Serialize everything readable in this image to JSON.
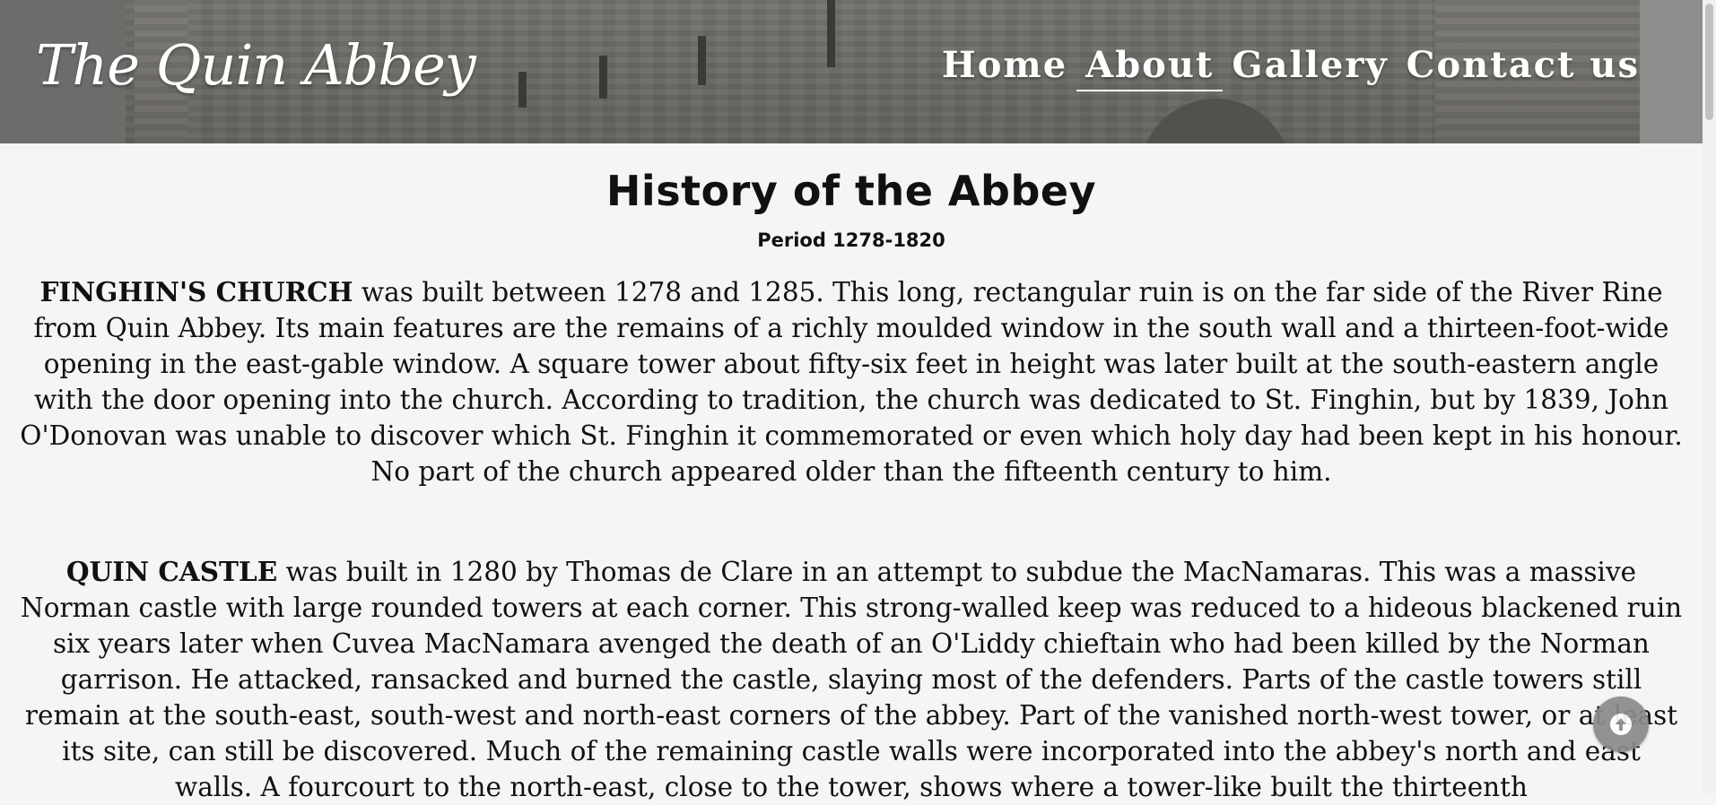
{
  "header": {
    "site_title": "The Quin Abbey",
    "nav": [
      {
        "label": "Home",
        "active": false
      },
      {
        "label": "About",
        "active": true
      },
      {
        "label": "Gallery",
        "active": false
      },
      {
        "label": "Contact us",
        "active": false
      }
    ]
  },
  "main": {
    "title": "History of the Abbey",
    "period": "Period 1278-1820",
    "sections": [
      {
        "heading": "FINGHIN'S CHURCH",
        "text": " was built between 1278 and 1285. This long, rectangular ruin is on the far side of the River Rine from Quin Abbey. Its main features are the remains of a richly moulded window in the south wall and a thirteen-foot-wide opening in the east-gable window. A square tower about fifty-six feet in height was later built at the south-eastern angle with the door opening into the church. According to tradition, the church was dedicated to St. Finghin, but by 1839, John O'Donovan was unable to discover which St. Finghin it commemorated or even which holy day had been kept in his honour. No part of the church appeared older than the fifteenth century to him."
      },
      {
        "heading": "QUIN CASTLE",
        "text": " was built in 1280 by Thomas de Clare in an attempt to subdue the MacNamaras. This was a massive Norman castle with large rounded towers at each corner. This strong-walled keep was reduced to a hideous blackened ruin six years later when Cuvea MacNamara avenged the death of an O'Liddy chieftain who had been killed by the Norman garrison. He attacked, ransacked and burned the castle, slaying most of the defenders. Parts of the castle towers still remain at the south-east, south-west and north-east corners of the abbey. Part of the vanished north-west tower, or at least its site, can still be discovered. Much of the remaining castle walls were incorporated into the abbey's north and east walls. A fourcourt to the north-east, close to the tower, shows where a tower-like built the thirteenth"
      }
    ]
  },
  "icons": {
    "back_to_top": "arrow-up-circle-icon"
  },
  "colors": {
    "background": "#f5f5f5",
    "text": "#111111",
    "nav_text": "#ffffff",
    "back_to_top": "#8a8a8a"
  }
}
